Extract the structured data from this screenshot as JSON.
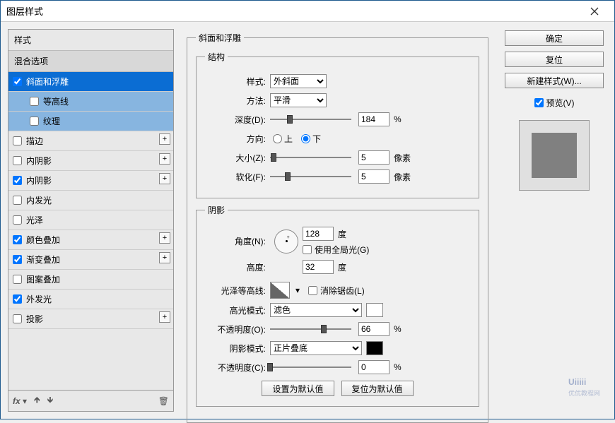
{
  "window": {
    "title": "图层样式"
  },
  "left": {
    "styles_header": "样式",
    "blend_header": "混合选项",
    "items": [
      {
        "label": "斜面和浮雕",
        "checked": true,
        "plus": false,
        "sub": false,
        "selected": true
      },
      {
        "label": "等高线",
        "checked": false,
        "plus": false,
        "sub": true,
        "selected": false,
        "subSelected": true
      },
      {
        "label": "纹理",
        "checked": false,
        "plus": false,
        "sub": true,
        "selected": false,
        "subSelected": true
      },
      {
        "label": "描边",
        "checked": false,
        "plus": true,
        "sub": false
      },
      {
        "label": "内阴影",
        "checked": false,
        "plus": true,
        "sub": false
      },
      {
        "label": "内阴影",
        "checked": true,
        "plus": true,
        "sub": false
      },
      {
        "label": "内发光",
        "checked": false,
        "plus": false,
        "sub": false
      },
      {
        "label": "光泽",
        "checked": false,
        "plus": false,
        "sub": false
      },
      {
        "label": "颜色叠加",
        "checked": true,
        "plus": true,
        "sub": false
      },
      {
        "label": "渐变叠加",
        "checked": true,
        "plus": true,
        "sub": false
      },
      {
        "label": "图案叠加",
        "checked": false,
        "plus": false,
        "sub": false
      },
      {
        "label": "外发光",
        "checked": true,
        "plus": false,
        "sub": false
      },
      {
        "label": "投影",
        "checked": false,
        "plus": true,
        "sub": false
      }
    ],
    "footer_fx": "fx"
  },
  "bevel": {
    "group_title": "斜面和浮雕",
    "structure_title": "结构",
    "style_label": "样式:",
    "style_value": "外斜面",
    "technique_label": "方法:",
    "technique_value": "平滑",
    "depth_label": "深度(D):",
    "depth_value": "184",
    "depth_unit": "%",
    "direction_label": "方向:",
    "direction_up": "上",
    "direction_down": "下",
    "size_label": "大小(Z):",
    "size_value": "5",
    "size_unit": "像素",
    "soften_label": "软化(F):",
    "soften_value": "5",
    "soften_unit": "像素"
  },
  "shadow": {
    "group_title": "阴影",
    "angle_label": "角度(N):",
    "angle_value": "128",
    "angle_unit": "度",
    "global_light_label": "使用全局光(G)",
    "altitude_label": "高度:",
    "altitude_value": "32",
    "altitude_unit": "度",
    "gloss_contour_label": "光泽等高线:",
    "anti_alias_label": "消除锯齿(L)",
    "highlight_mode_label": "高光模式:",
    "highlight_mode_value": "滤色",
    "highlight_color": "#ffffff",
    "opacity1_label": "不透明度(O):",
    "opacity1_value": "66",
    "opacity1_unit": "%",
    "shadow_mode_label": "阴影模式:",
    "shadow_mode_value": "正片叠底",
    "shadow_color": "#000000",
    "opacity2_label": "不透明度(C):",
    "opacity2_value": "0",
    "opacity2_unit": "%"
  },
  "buttons": {
    "make_default": "设置为默认值",
    "reset_default": "复位为默认值"
  },
  "right": {
    "ok": "确定",
    "cancel": "复位",
    "new_style": "新建样式(W)...",
    "preview": "预览(V)"
  },
  "watermark": {
    "main": "Uiiiii",
    "sub": "优优教程网"
  }
}
